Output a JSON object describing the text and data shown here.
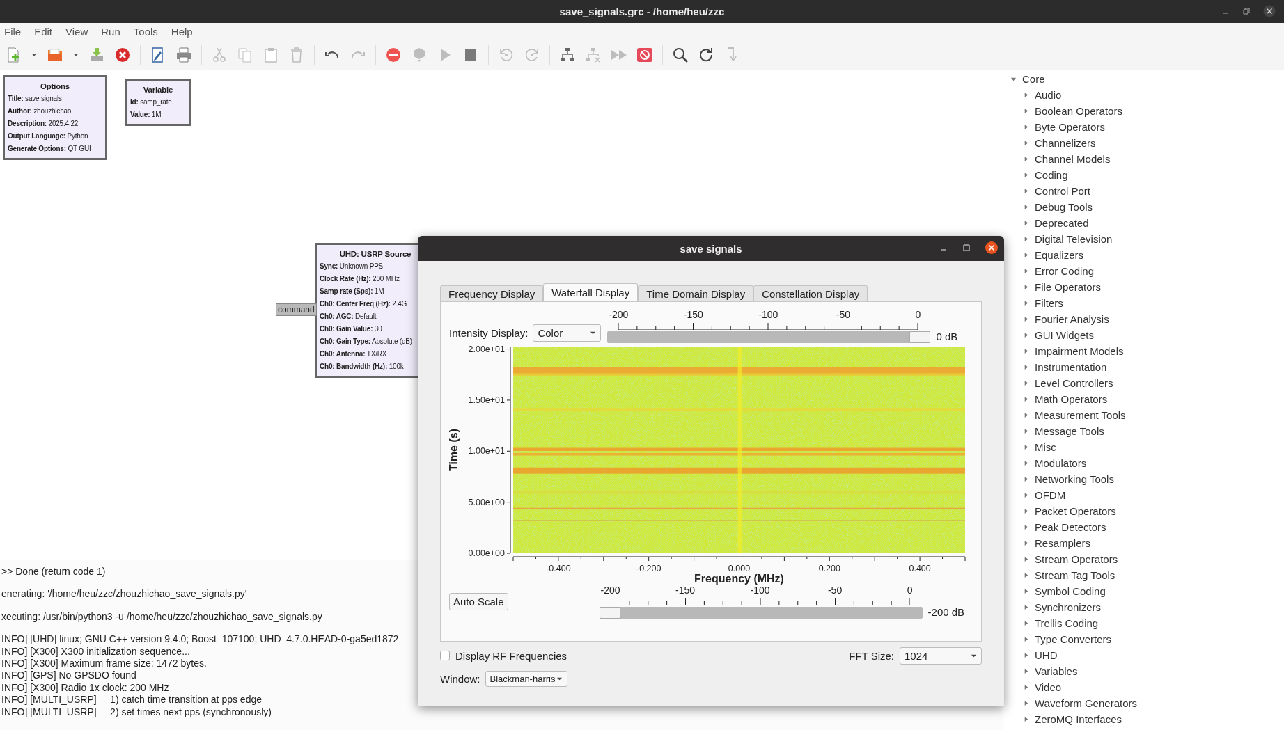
{
  "window": {
    "title": "save_signals.grc - /home/heu/zzc"
  },
  "menu": [
    "File",
    "Edit",
    "View",
    "Run",
    "Tools",
    "Help"
  ],
  "toolbar": [
    [
      {
        "kind": "new",
        "disabled": false
      },
      {
        "kind": "caret",
        "disabled": false
      },
      {
        "kind": "open",
        "disabled": false
      },
      {
        "kind": "caret",
        "disabled": false
      },
      {
        "kind": "save",
        "disabled": false
      },
      {
        "kind": "close",
        "disabled": false
      }
    ],
    [
      {
        "kind": "edit",
        "disabled": false
      },
      {
        "kind": "print",
        "disabled": false
      }
    ],
    [
      {
        "kind": "cut",
        "disabled": true
      },
      {
        "kind": "copy",
        "disabled": true
      },
      {
        "kind": "paste",
        "disabled": true
      },
      {
        "kind": "delete",
        "disabled": true
      }
    ],
    [
      {
        "kind": "undo",
        "disabled": false
      },
      {
        "kind": "redo",
        "disabled": true
      }
    ],
    [
      {
        "kind": "kill",
        "disabled": false
      },
      {
        "kind": "gen",
        "disabled": true
      },
      {
        "kind": "run",
        "disabled": true
      },
      {
        "kind": "stop",
        "disabled": false
      }
    ],
    [
      {
        "kind": "rotate-ccw",
        "disabled": true
      },
      {
        "kind": "rotate-cw",
        "disabled": true
      }
    ],
    [
      {
        "kind": "tree",
        "disabled": false
      },
      {
        "kind": "tree-x",
        "disabled": true
      },
      {
        "kind": "fast-forward",
        "disabled": true
      },
      {
        "kind": "bypass",
        "disabled": false
      }
    ],
    [
      {
        "kind": "search",
        "disabled": false
      },
      {
        "kind": "reload",
        "disabled": false
      },
      {
        "kind": "arrow-down",
        "disabled": true
      }
    ]
  ],
  "canvas": {
    "blocks": [
      {
        "title": "Options",
        "params": [
          "**Title:** save signals",
          "**Author:** zhouzhichao",
          "**Description:** 2025.4.22",
          "**Output Language:** Python",
          "**Generate Options:** QT GUI"
        ]
      },
      {
        "title": "Variable",
        "params": [
          "**Id:** samp_rate",
          "**Value:** 1M"
        ]
      },
      {
        "title": "UHD: USRP Source",
        "params": [
          "**Sync:** Unknown PPS",
          "**Clock Rate (Hz):** 200 MHz",
          "**Samp rate (Sps):** 1M",
          "**Ch0: Center Freq (Hz):** 2.4G",
          "**Ch0: AGC:** Default",
          "**Ch0: Gain Value:** 30",
          "**Ch0: Gain Type:** Absolute (dB)",
          "**Ch0: Antenna:** TX/RX",
          "**Ch0: Bandwidth (Hz):** 100k"
        ]
      }
    ],
    "port": "command"
  },
  "console": [
    [
      ">> Done (return code 1)"
    ],
    [
      "enerating: '/home/heu/zzc/zhouzhichao_save_signals.py'"
    ],
    [
      "xecuting: /usr/bin/python3 -u /home/heu/zzc/zhouzhichao_save_signals.py"
    ],
    [
      "INFO] [UHD] linux; GNU C++ version 9.4.0; Boost_107100; UHD_4.7.0.HEAD-0-ga5ed1872",
      "INFO] [X300] X300 initialization sequence...",
      "INFO] [X300] Maximum frame size: 1472 bytes.",
      "INFO] [GPS] No GPSDO found",
      "INFO] [X300] Radio 1x clock: 200 MHz",
      "INFO] [MULTI_USRP]     1) catch time transition at pps edge",
      "INFO] [MULTI_USRP]     2) set times next pps (synchronously)"
    ]
  ],
  "block_tree": {
    "label": "Core",
    "expanded": true,
    "children": [
      {
        "label": "Audio",
        "expanded": false
      },
      {
        "label": "Boolean Operators",
        "expanded": false
      },
      {
        "label": "Byte Operators",
        "expanded": false
      },
      {
        "label": "Channelizers",
        "expanded": false
      },
      {
        "label": "Channel Models",
        "expanded": false
      },
      {
        "label": "Coding",
        "expanded": false
      },
      {
        "label": "Control Port",
        "expanded": false
      },
      {
        "label": "Debug Tools",
        "expanded": false
      },
      {
        "label": "Deprecated",
        "expanded": false
      },
      {
        "label": "Digital Television",
        "expanded": false
      },
      {
        "label": "Equalizers",
        "expanded": false
      },
      {
        "label": "Error Coding",
        "expanded": false
      },
      {
        "label": "File Operators",
        "expanded": false
      },
      {
        "label": "Filters",
        "expanded": false
      },
      {
        "label": "Fourier Analysis",
        "expanded": false
      },
      {
        "label": "GUI Widgets",
        "expanded": false
      },
      {
        "label": "Impairment Models",
        "expanded": false
      },
      {
        "label": "Instrumentation",
        "expanded": false
      },
      {
        "label": "Level Controllers",
        "expanded": false
      },
      {
        "label": "Math Operators",
        "expanded": false
      },
      {
        "label": "Measurement Tools",
        "expanded": false
      },
      {
        "label": "Message Tools",
        "expanded": false
      },
      {
        "label": "Misc",
        "expanded": false
      },
      {
        "label": "Modulators",
        "expanded": false
      },
      {
        "label": "Networking Tools",
        "expanded": false
      },
      {
        "label": "OFDM",
        "expanded": false
      },
      {
        "label": "Packet Operators",
        "expanded": false
      },
      {
        "label": "Peak Detectors",
        "expanded": false
      },
      {
        "label": "Resamplers",
        "expanded": false
      },
      {
        "label": "Stream Operators",
        "expanded": false
      },
      {
        "label": "Stream Tag Tools",
        "expanded": false
      },
      {
        "label": "Symbol Coding",
        "expanded": false
      },
      {
        "label": "Synchronizers",
        "expanded": false
      },
      {
        "label": "Trellis Coding",
        "expanded": false
      },
      {
        "label": "Type Converters",
        "expanded": false
      },
      {
        "label": "UHD",
        "expanded": false
      },
      {
        "label": "Variables",
        "expanded": false
      },
      {
        "label": "Video",
        "expanded": false
      },
      {
        "label": "Waveform Generators",
        "expanded": false
      },
      {
        "label": "ZeroMQ Interfaces",
        "expanded": false
      }
    ]
  },
  "dialog": {
    "title": "save signals",
    "tabs": [
      {
        "label": "Frequency Display",
        "selected": false
      },
      {
        "label": "Waterfall Display",
        "selected": true
      },
      {
        "label": "Time Domain Display",
        "selected": false
      },
      {
        "label": "Constellation Display",
        "selected": false
      }
    ],
    "intensity": {
      "label": "Intensity Display:",
      "value": "Color"
    },
    "max_slider": {
      "ticks": [
        "-200",
        "-150",
        "-100",
        "-50",
        "0"
      ],
      "level": 1,
      "reading": "0 dB"
    },
    "plot": {
      "ylabel": "Time (s)",
      "xlabel": "Frequency (MHz)",
      "yticks": [
        "2.00e+01",
        "1.50e+01",
        "1.00e+01",
        "5.00e+00",
        "0.00e+00"
      ],
      "xticks": [
        "-0.400",
        "-0.200",
        "0.000",
        "0.200",
        "0.400"
      ]
    },
    "auto_scale": "Auto Scale",
    "min_slider": {
      "ticks": [
        "-200",
        "-150",
        "-100",
        "-50",
        "0"
      ],
      "level": 0,
      "reading": "-200 dB"
    },
    "rf_frequencies": {
      "label": "Display RF Frequencies",
      "checked": false
    },
    "fft_size": {
      "label": "FFT Size:",
      "value": "1024"
    },
    "window_fn": {
      "label": "Window:",
      "value": "Blackman-harris"
    }
  }
}
